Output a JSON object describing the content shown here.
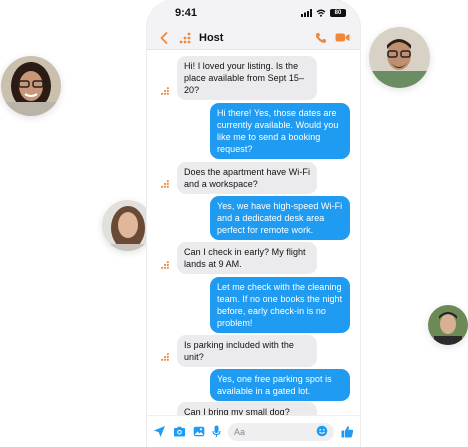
{
  "status_bar": {
    "time": "9:41",
    "battery": "80"
  },
  "chat_header": {
    "title": "Host"
  },
  "messages": [
    {
      "direction": "in",
      "text": "Hi! I loved your listing. Is the place available from Sept 15–20?"
    },
    {
      "direction": "out",
      "text": "Hi there! Yes, those dates are currently available. Would you like me to send a booking request?"
    },
    {
      "direction": "in",
      "text": "Does the apartment have Wi-Fi and a workspace?"
    },
    {
      "direction": "out",
      "text": "Yes, we have high-speed Wi-Fi and a dedicated desk area perfect for remote work."
    },
    {
      "direction": "in",
      "text": "Can I check in early? My flight lands at 9 AM."
    },
    {
      "direction": "out",
      "text": "Let me check with the cleaning team. If no one books the night before, early check-in is no problem!"
    },
    {
      "direction": "in",
      "text": "Is parking included with the unit?"
    },
    {
      "direction": "out",
      "text": "Yes, one free parking spot is available in a gated lot."
    },
    {
      "direction": "in",
      "text": "Can I bring my small dog?"
    }
  ],
  "composer": {
    "placeholder": "Aa"
  },
  "colors": {
    "accent": "#1f9cf2",
    "host_orange": "#f0883a",
    "incoming_bubble": "#ebebed"
  },
  "icons": {
    "back": "chevron-left-icon",
    "call": "phone-icon",
    "video": "video-camera-icon",
    "send": "send-arrow-icon",
    "camera": "camera-icon",
    "gallery": "image-icon",
    "mic": "microphone-icon",
    "emoji": "emoji-icon",
    "like": "thumbs-up-icon"
  }
}
